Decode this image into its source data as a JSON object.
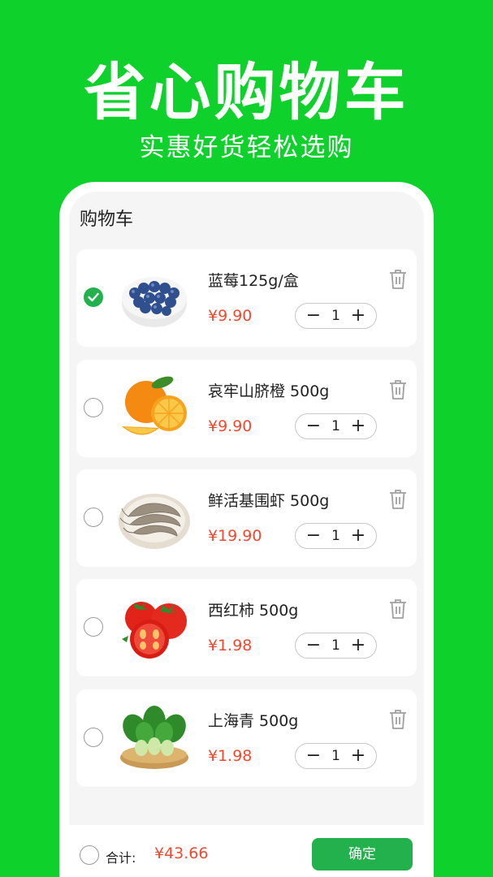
{
  "hero": {
    "title": "省心购物车",
    "subtitle": "实惠好货轻松选购"
  },
  "cart": {
    "title": "购物车",
    "items": [
      {
        "name": "蓝莓125g/盒",
        "price": "¥9.90",
        "qty": "1",
        "checked": true,
        "image": "blueberries-image"
      },
      {
        "name": "哀牢山脐橙 500g",
        "price": "¥9.90",
        "qty": "1",
        "checked": false,
        "image": "oranges-image"
      },
      {
        "name": "鲜活基围虾 500g",
        "price": "¥19.90",
        "qty": "1",
        "checked": false,
        "image": "shrimp-image"
      },
      {
        "name": "西红柿 500g",
        "price": "¥1.98",
        "qty": "1",
        "checked": false,
        "image": "tomatoes-image"
      },
      {
        "name": "上海青 500g",
        "price": "¥1.98",
        "qty": "1",
        "checked": false,
        "image": "bok-choy-image"
      }
    ],
    "minus_symbol": "−",
    "plus_symbol": "+"
  },
  "footer": {
    "total_label": "合计:",
    "total_value": "¥43.66",
    "confirm_label": "确定"
  },
  "colors": {
    "background": "#0fd12b",
    "accent_green": "#22b14c",
    "price_red": "#f2492e"
  },
  "icons": [
    "check-icon",
    "trash-icon",
    "minus-icon",
    "plus-icon"
  ]
}
